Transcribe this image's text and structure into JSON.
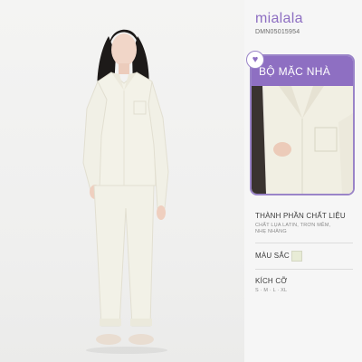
{
  "brand": {
    "name": "mialala",
    "code": "DMN05015954"
  },
  "detail_card": {
    "title": "BỘ MẶC NHÀ",
    "badge_icon": "heart-icon"
  },
  "specs": {
    "material": {
      "label": "THÀNH PHẦN CHẤT LIỆU",
      "value_line1": "CHẤT LỤA LATIN, TRƠN MỀM,",
      "value_line2": "NHẸ NHÀNG"
    },
    "color": {
      "label": "MÀU SẮC",
      "swatch": "#e8ecd6"
    },
    "size": {
      "label": "KÍCH CỠ",
      "value": "S · M · L · XL"
    }
  },
  "colors": {
    "accent": "#8e6fc2",
    "panel_bg": "#f6f6f6",
    "outfit": "#f3f2e8"
  }
}
